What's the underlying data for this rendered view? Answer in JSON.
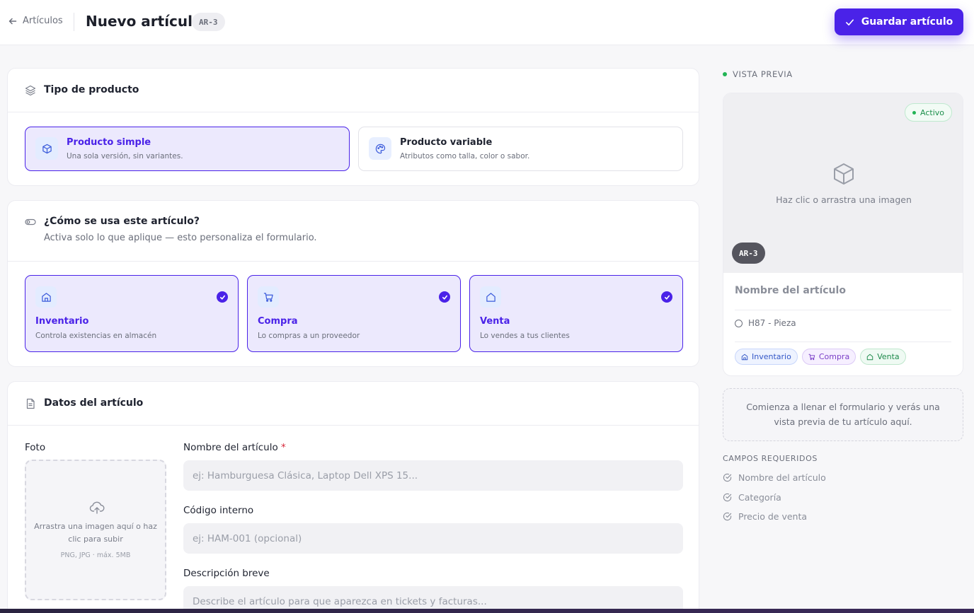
{
  "header": {
    "back_label": "Artículos",
    "title": "Nuevo artículo",
    "code": "AR-3",
    "save_label": "Guardar artículo"
  },
  "product_type": {
    "title": "Tipo de producto",
    "options": [
      {
        "title": "Producto simple",
        "subtitle": "Una sola versión, sin variantes.",
        "selected": true,
        "icon": "cube-icon"
      },
      {
        "title": "Producto variable",
        "subtitle": "Atributos como talla, color o sabor.",
        "selected": false,
        "icon": "palette-icon"
      }
    ]
  },
  "usage": {
    "title": "¿Cómo se usa este artículo?",
    "subtitle": "Activa solo lo que aplique — esto personaliza el formulario.",
    "options": [
      {
        "title": "Inventario",
        "subtitle": "Controla existencias en almacén",
        "checked": true,
        "icon": "warehouse-icon"
      },
      {
        "title": "Compra",
        "subtitle": "Lo compras a un proveedor",
        "checked": true,
        "icon": "cart-icon"
      },
      {
        "title": "Venta",
        "subtitle": "Lo vendes a tus clientes",
        "checked": true,
        "icon": "store-icon"
      }
    ]
  },
  "details": {
    "title": "Datos del artículo",
    "photo_label": "Foto",
    "dropzone_text": "Arrastra una imagen aquí o haz clic para subir",
    "dropzone_hint": "PNG, JPG · máx. 5MB",
    "name_label": "Nombre del artículo",
    "name_required": "*",
    "name_placeholder": "ej: Hamburguesa Clásica, Laptop Dell XPS 15...",
    "name_value": "",
    "code_label": "Código interno",
    "code_placeholder": "ej: HAM-001 (opcional)",
    "code_value": "",
    "desc_label": "Descripción breve",
    "desc_placeholder": "Describe el artículo para que aparezca en tickets y facturas...",
    "desc_value": ""
  },
  "preview": {
    "label": "VISTA PREVIA",
    "status": "Activo",
    "image_text": "Haz clic o arrastra una imagen",
    "code": "AR-3",
    "name": "Nombre del artículo",
    "unit": "H87 - Pieza",
    "tags": [
      "Inventario",
      "Compra",
      "Venta"
    ],
    "hint": "Comienza a llenar el formulario y verás una vista previa de tu artículo aquí."
  },
  "required_fields": {
    "title": "CAMPOS REQUERIDOS",
    "items": [
      "Nombre del artículo",
      "Categoría",
      "Precio de venta"
    ]
  },
  "colors": {
    "accent": "#4a22e8",
    "active": "#22b455"
  }
}
